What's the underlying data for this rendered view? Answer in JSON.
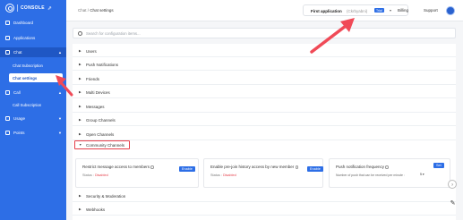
{
  "sidebar": {
    "logo_text": "CONSOLE",
    "nav": [
      {
        "label": "Dashboard"
      },
      {
        "label": "Applications"
      },
      {
        "label": "Chat"
      },
      {
        "label": "Chat Subscription"
      },
      {
        "label": "Chat settings"
      },
      {
        "label": "Call"
      },
      {
        "label": "Call Subscription"
      },
      {
        "label": "Usage"
      },
      {
        "label": "Points"
      }
    ]
  },
  "header": {
    "breadcrumb_root": "Chat",
    "breadcrumb_sep": "/",
    "breadcrumb_current": "Chat settings",
    "app_name": "First application",
    "app_id": "(Ckrbyabni)",
    "app_badge": "Trial",
    "billing": "Billing",
    "support": "Support"
  },
  "search": {
    "placeholder": "Search for configuration items..."
  },
  "sections": [
    {
      "label": "Users"
    },
    {
      "label": "Push Notifications"
    },
    {
      "label": "Friends"
    },
    {
      "label": "Multi Devices"
    },
    {
      "label": "Messages"
    },
    {
      "label": "Group Channels"
    },
    {
      "label": "Open Channels"
    },
    {
      "label": "Community Channels"
    },
    {
      "label": "Security & Moderation"
    },
    {
      "label": "Webhooks"
    }
  ],
  "cards": [
    {
      "title": "Restrict message access to members",
      "status_label": "Status :",
      "status_value": "Disabled",
      "button": "Enable"
    },
    {
      "title": "Enable pre-join history access by new member",
      "status_label": "Status :",
      "status_value": "Disabled",
      "button": "Enable"
    },
    {
      "title": "Push notification frequency",
      "subtitle": "Number of push that can be received per minute :",
      "select_value": "5",
      "button": "Set"
    }
  ],
  "colors": {
    "brand": "#2d6ee6",
    "highlight": "#e53e4a"
  }
}
